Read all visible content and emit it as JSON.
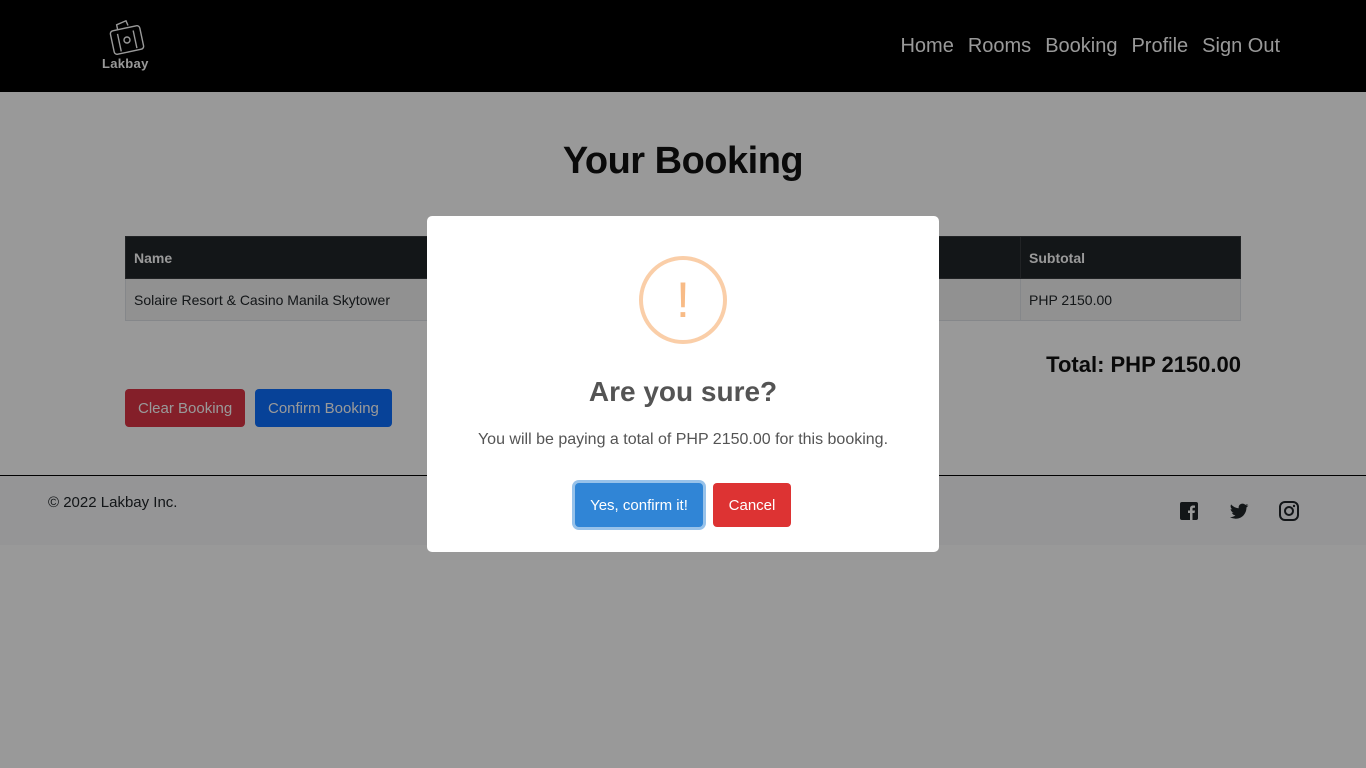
{
  "brand": {
    "name": "Lakbay",
    "logo_icon": "suitcase-icon"
  },
  "nav": {
    "items": [
      "Home",
      "Rooms",
      "Booking",
      "Profile",
      "Sign Out"
    ]
  },
  "main": {
    "title": "Your Booking",
    "table": {
      "headers": {
        "name": "Name",
        "subtotal": "Subtotal"
      },
      "rows": [
        {
          "name": "Solaire Resort & Casino Manila Skytower",
          "subtotal": "PHP 2150.00"
        }
      ]
    },
    "total": "Total: PHP 2150.00",
    "clear_label": "Clear Booking",
    "confirm_label": "Confirm Booking"
  },
  "footer": {
    "copyright": "© 2022 Lakbay Inc.",
    "social_icons": [
      "facebook-icon",
      "twitter-icon",
      "instagram-icon"
    ]
  },
  "modal": {
    "icon": "exclamation",
    "icon_glyph": "!",
    "title": "Are you sure?",
    "text": "You will be paying a total of PHP 2150.00 for this booking.",
    "yes_label": "Yes, confirm it!",
    "cancel_label": "Cancel"
  },
  "colors": {
    "navbar": "#000000",
    "danger": "#dc3545",
    "primary": "#0d6efd",
    "modal_confirm": "#3085d6",
    "modal_cancel": "#dd3333",
    "warning_icon": "#f8bb86"
  }
}
